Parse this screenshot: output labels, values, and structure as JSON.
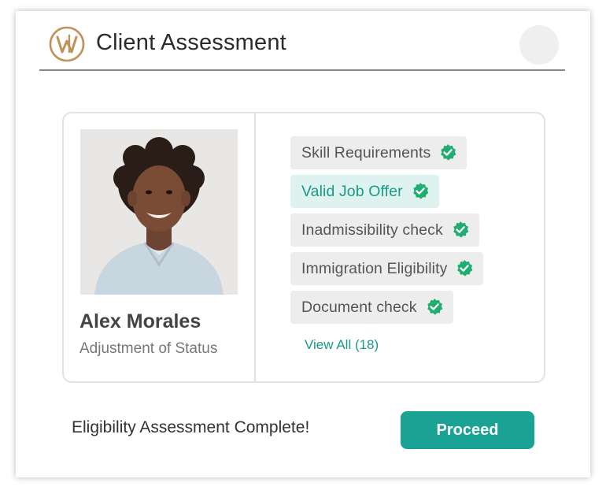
{
  "header": {
    "title": "Client Assessment",
    "logo_icon": "circled-w-logo-icon",
    "brand_color": "#c1915a"
  },
  "client": {
    "name": "Alex Morales",
    "case_type": "Adjustment of Status"
  },
  "checks": [
    {
      "label": "Skill Requirements",
      "status": "complete",
      "active": false
    },
    {
      "label": "Valid Job Offer",
      "status": "complete",
      "active": true
    },
    {
      "label": "Inadmissibility check",
      "status": "complete",
      "active": false
    },
    {
      "label": "Immigration Eligibility",
      "status": "complete",
      "active": false
    },
    {
      "label": "Document check",
      "status": "complete",
      "active": false
    }
  ],
  "view_all_label": "View All (18)",
  "footer": {
    "status_text": "Eligibility Assessment Complete!",
    "proceed_label": "Proceed"
  },
  "colors": {
    "accent": "#1aa394",
    "check_badge": "#1fae6f",
    "active_pill_bg": "#def3f0"
  }
}
